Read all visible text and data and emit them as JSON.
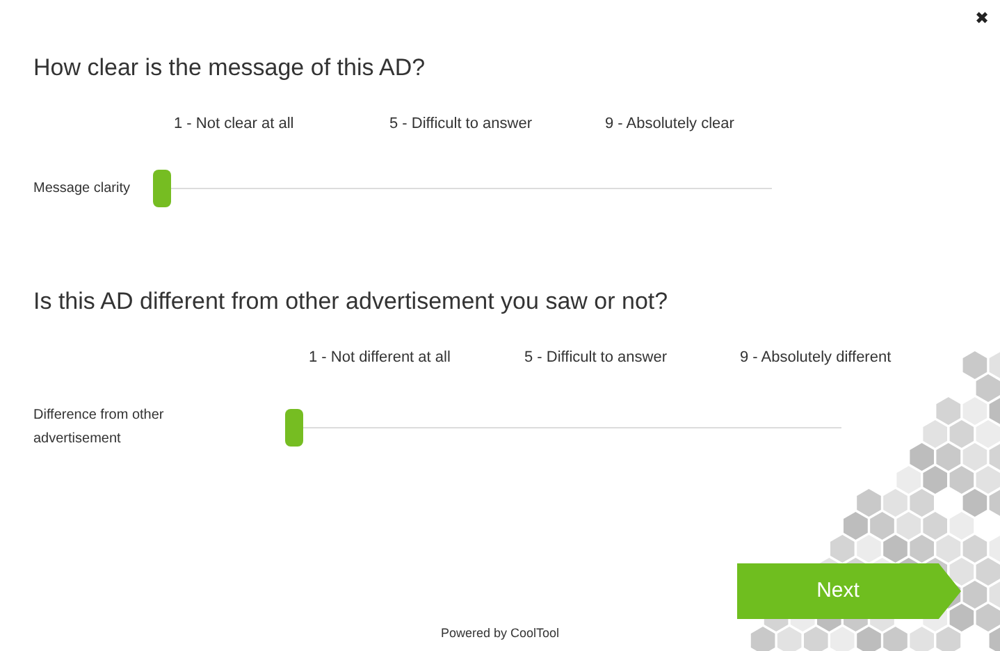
{
  "close_button": {
    "label": "✖"
  },
  "questions": [
    {
      "title": "How clear is the message of this AD?",
      "scale_labels": [
        "1 - Not clear at all",
        "5 - Difficult to answer",
        "9 - Absolutely clear"
      ],
      "slider": {
        "label": "Message clarity",
        "level": 0
      }
    },
    {
      "title": "Is this AD different from other advertisement you saw or not?",
      "scale_labels": [
        "1 - Not different at all",
        "5 - Difficult to answer",
        "9 - Absolutely different"
      ],
      "slider": {
        "label": "Difference from other advertisement",
        "level": 0
      }
    }
  ],
  "next_button": {
    "label": "Next"
  },
  "footer": {
    "text": "Powered by CoolTool"
  }
}
